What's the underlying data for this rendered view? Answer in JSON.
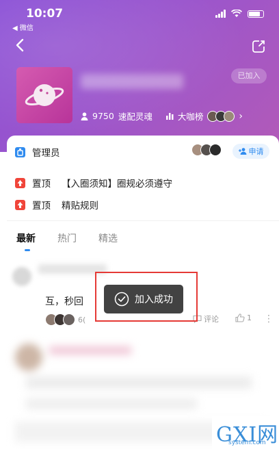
{
  "status_bar": {
    "time": "10:07",
    "back_app": "◀ 微信"
  },
  "header": {
    "joined_label": "已加入",
    "members_count": "9750",
    "members_label": "速配灵魂",
    "rank_label": "大咖榜"
  },
  "admin": {
    "label": "管理员",
    "apply_label": "申请"
  },
  "pinned": [
    {
      "tag": "置顶",
      "title": "【入圈须知】圈规必须遵守"
    },
    {
      "tag": "置顶",
      "title": "精贴规则"
    }
  ],
  "tabs": [
    {
      "label": "最新",
      "active": true
    },
    {
      "label": "热门",
      "active": false
    },
    {
      "label": "精选",
      "active": false
    }
  ],
  "post": {
    "text": "互，秒回",
    "likes_suffix": "6(",
    "comment_label": "评论",
    "like_count": "1"
  },
  "toast": {
    "text": "加入成功"
  },
  "watermark": {
    "main": "GXI网",
    "sub": "system.com"
  },
  "colors": {
    "accent": "#2f8bef",
    "header_start": "#8a4fd6",
    "header_end": "#b25ab8",
    "highlight": "#e53935"
  }
}
